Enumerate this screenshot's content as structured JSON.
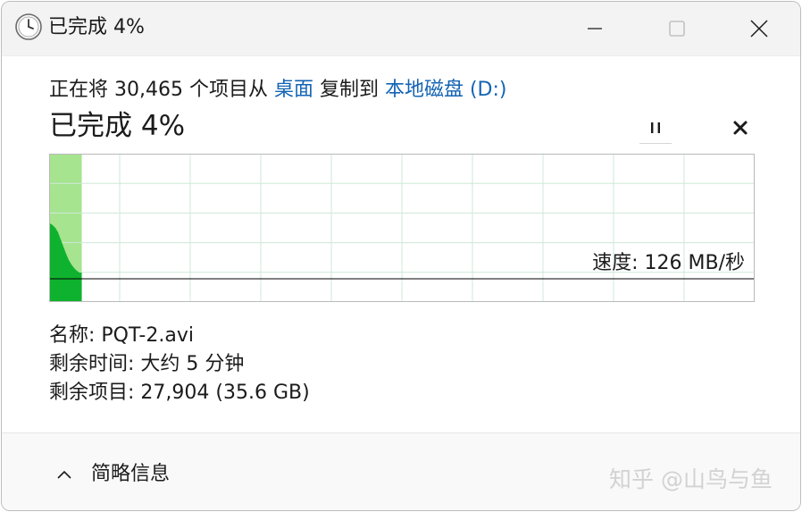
{
  "titlebar": {
    "title": "已完成 4%",
    "icon": "clock-icon",
    "controls": [
      "minimize-icon",
      "maximize-icon",
      "close-icon"
    ]
  },
  "copy": {
    "prefix": "正在将 30,465 个项目从 ",
    "source": "桌面",
    "middle": " 复制到 ",
    "destination": "本地磁盘 (D:)"
  },
  "status": {
    "percent_text": "已完成 4%",
    "progress_percent": 4
  },
  "actions": {
    "pause_icon": "pause-icon",
    "cancel_icon": "close-icon"
  },
  "graph": {
    "speed_text": "速度: 126 MB/秒",
    "progress_fraction": 0.045,
    "colors": {
      "background": "#ffffff",
      "grid": "#cfe8d8",
      "border": "#b9b9b9",
      "progress_fill": "#a6e48f",
      "speed_fill": "#0fb22e",
      "speed_line": "#000000"
    }
  },
  "details": {
    "name_label": "名称: ",
    "name_value": "PQT-2.avi",
    "time_label": "剩余时间: ",
    "time_value": "大约 5 分钟",
    "items_label": "剩余项目: ",
    "items_value": "27,904 (35.6 GB)"
  },
  "footer": {
    "toggle_label": "简略信息",
    "toggle_icon": "chevron-up-icon",
    "watermark": "知乎 @山鸟与鱼"
  }
}
